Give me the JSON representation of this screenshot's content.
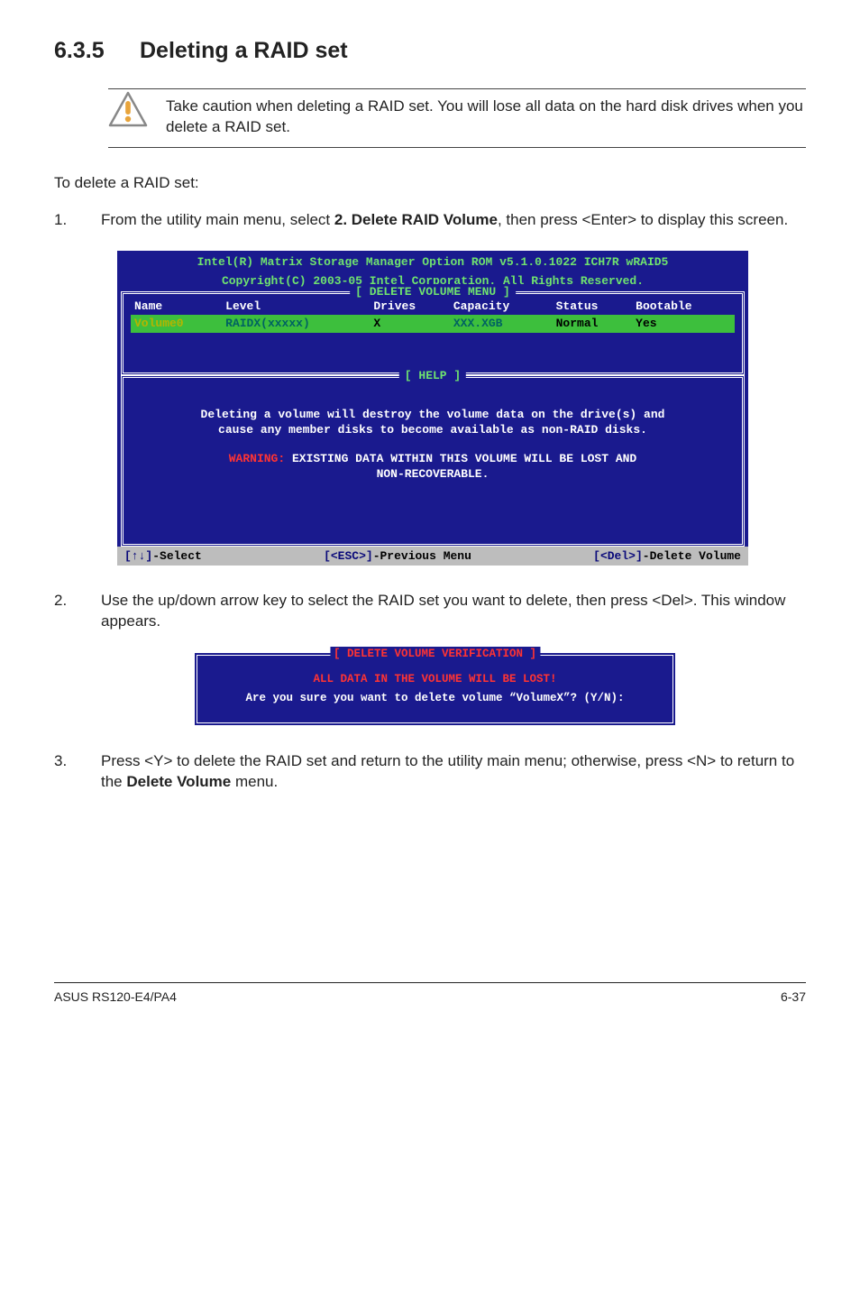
{
  "heading": {
    "number": "6.3.5",
    "title": "Deleting a RAID set"
  },
  "callout": "Take caution when deleting a RAID set. You will lose all data on the hard disk drives when you delete a RAID set.",
  "intro": "To delete a RAID set:",
  "step1": {
    "n": "1.",
    "pre": "From the utility main menu, select ",
    "bold": "2. Delete RAID Volume",
    "post": ", then press <Enter> to display this screen."
  },
  "bios1": {
    "hdr1": "Intel(R) Matrix Storage Manager Option ROM v5.1.0.1022 ICH7R wRAID5",
    "hdr2": "Copyright(C) 2003-05 Intel Corporation. All Rights Reserved.",
    "frame_label": "[ DELETE VOLUME MENU ]",
    "cols": [
      "Name",
      "Level",
      "Drives",
      "Capacity",
      "Status",
      "Bootable"
    ],
    "row": [
      "Volume0",
      "RAIDX(xxxxx)",
      "X",
      "XXX.XGB",
      "Normal",
      "Yes"
    ],
    "help_label": "[ HELP ]",
    "help1": "Deleting a volume will destroy the volume data on the drive(s) and",
    "help2": "cause any member disks to become available as non-RAID disks.",
    "warn_lbl": "WARNING:",
    "warn_txt": " EXISTING DATA WITHIN THIS VOLUME WILL BE LOST AND",
    "warn_txt2": "NON-RECOVERABLE.",
    "foot_left_k": "[↑↓]",
    "foot_left_t": "-Select",
    "foot_mid_k": "[<ESC>]",
    "foot_mid_t": "-Previous Menu",
    "foot_right_k": "[<Del>]",
    "foot_right_t": "-Delete Volume"
  },
  "step2": {
    "n": "2.",
    "t": "Use the up/down arrow key to select the RAID set you want to delete, then press <Del>. This window appears."
  },
  "bios2": {
    "title": "[ DELETE VOLUME VERIFICATION ]",
    "red": "ALL DATA IN THE VOLUME WILL BE LOST!",
    "q": "Are you sure you want to delete volume “VolumeX”? (Y/N):"
  },
  "step3": {
    "n": "3.",
    "pre": "Press <Y> to delete the RAID set and return to the utility main menu; otherwise, press <N> to return to the ",
    "bold": "Delete Volume",
    "post": " menu."
  },
  "footer": {
    "left": "ASUS RS120-E4/PA4",
    "right": "6-37"
  }
}
